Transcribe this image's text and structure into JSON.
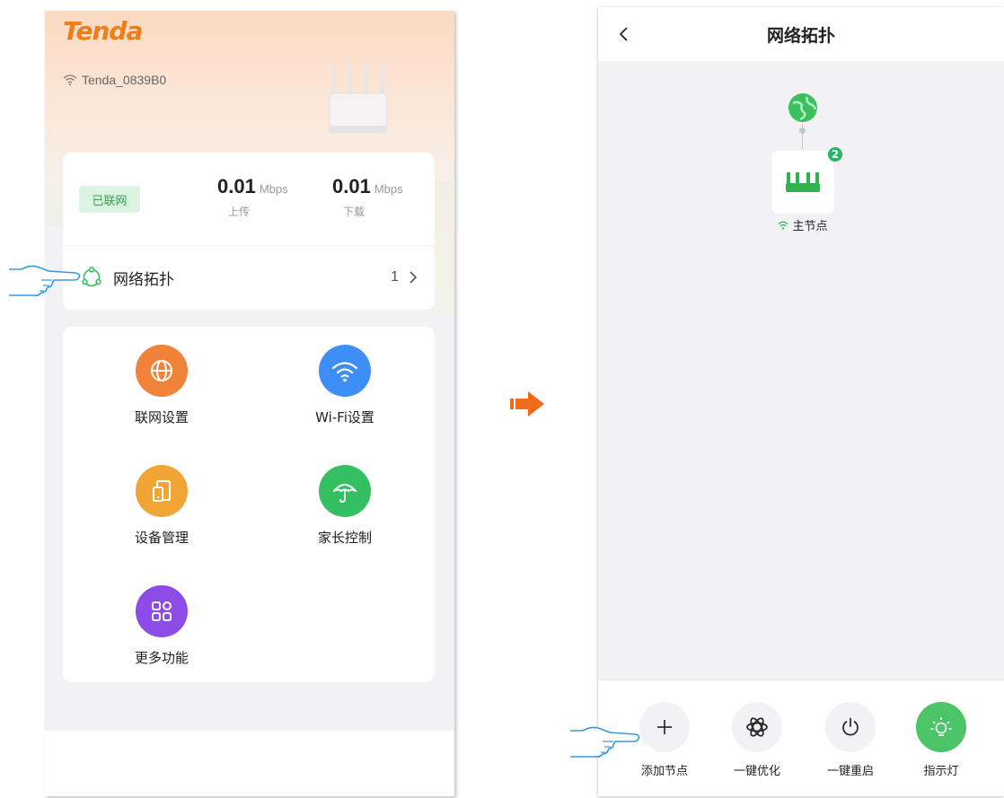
{
  "left": {
    "brand": "Tenda",
    "ssid": "Tenda_0839B0",
    "status_badge": "已联网",
    "upload": {
      "value": "0.01",
      "unit": "Mbps",
      "label": "上传"
    },
    "download": {
      "value": "0.01",
      "unit": "Mbps",
      "label": "下载"
    },
    "topology": {
      "label": "网络拓扑",
      "count": "1"
    },
    "functions": [
      {
        "label": "联网设置",
        "icon": "globe-icon",
        "color": "#f0823a"
      },
      {
        "label": "Wi-Fi设置",
        "icon": "wifi-icon",
        "color": "#3e8ef7"
      },
      {
        "label": "设备管理",
        "icon": "device-icon",
        "color": "#f1a535"
      },
      {
        "label": "家长控制",
        "icon": "umbrella-icon",
        "color": "#34bf62"
      },
      {
        "label": "更多功能",
        "icon": "grid-icon",
        "color": "#8d4be8"
      }
    ]
  },
  "right": {
    "title": "网络拓扑",
    "node": {
      "label": "主节点",
      "badge": "2"
    },
    "actions": [
      {
        "label": "添加节点",
        "icon": "plus-icon"
      },
      {
        "label": "一键优化",
        "icon": "atom-icon"
      },
      {
        "label": "一键重启",
        "icon": "power-icon"
      },
      {
        "label": "指示灯",
        "icon": "light-icon",
        "active": true
      }
    ]
  },
  "colors": {
    "brand_orange": "#f07d1a",
    "success_green": "#2ea24c",
    "arrow_orange": "#f26a1b",
    "hand_outline": "#3a9ad9"
  }
}
